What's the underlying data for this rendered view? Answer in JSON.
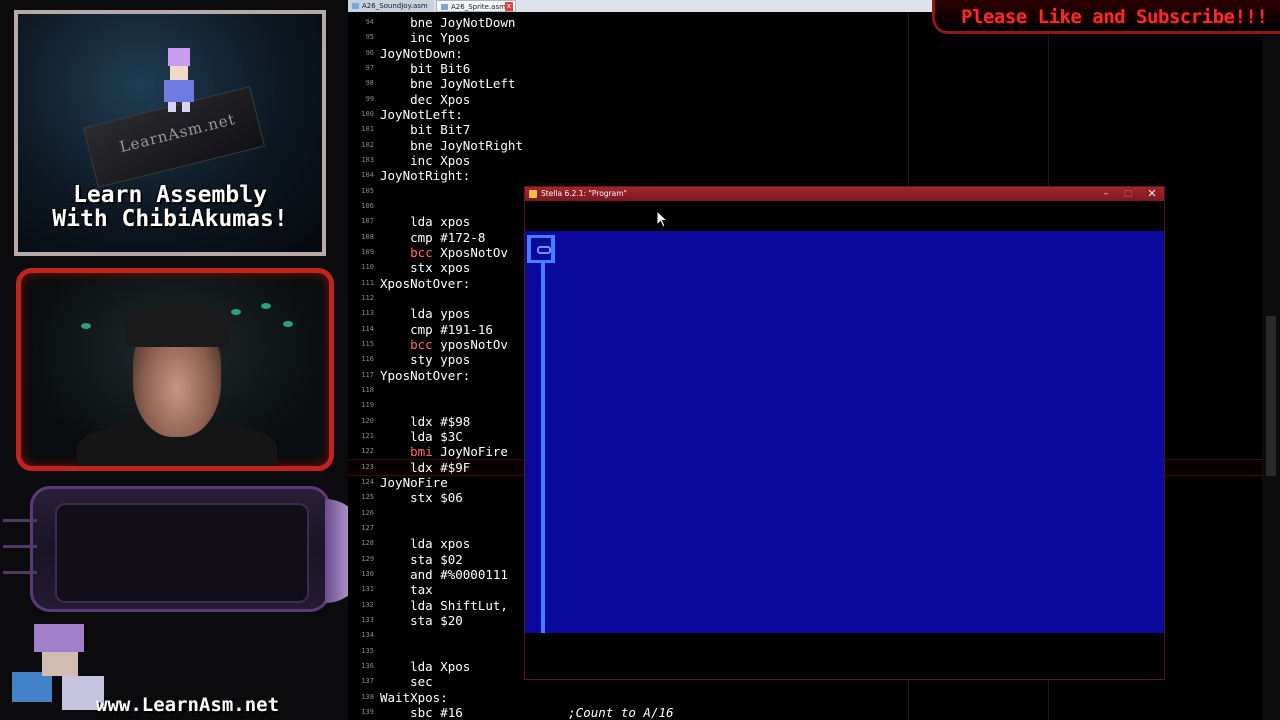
{
  "left_panel": {
    "promo_board_text": "LearnAsm.net",
    "promo_title_line1": "Learn Assembly",
    "promo_title_line2": "With ChibiAkumas!",
    "website": "www.LearnAsm.net"
  },
  "editor": {
    "tabs": [
      {
        "label": "A26_SoundJoy.asm"
      },
      {
        "label": "A26_Sprite.asm",
        "close": "x"
      }
    ],
    "lines": [
      {
        "n": "94",
        "seg": [
          {
            "t": "    bne JoyNotDown",
            "c": "ins"
          }
        ]
      },
      {
        "n": "95",
        "seg": [
          {
            "t": "    inc Ypos",
            "c": "ins"
          }
        ]
      },
      {
        "n": "96",
        "seg": [
          {
            "t": "JoyNotDown:",
            "c": "lbl"
          }
        ]
      },
      {
        "n": "97",
        "seg": [
          {
            "t": "    bit Bit6",
            "c": "ins"
          }
        ]
      },
      {
        "n": "98",
        "seg": [
          {
            "t": "    bne JoyNotLeft",
            "c": "ins"
          }
        ]
      },
      {
        "n": "99",
        "seg": [
          {
            "t": "    dec Xpos",
            "c": "ins"
          }
        ]
      },
      {
        "n": "100",
        "seg": [
          {
            "t": "JoyNotLeft:",
            "c": "lbl"
          }
        ]
      },
      {
        "n": "101",
        "seg": [
          {
            "t": "    bit Bit7",
            "c": "ins"
          }
        ]
      },
      {
        "n": "102",
        "seg": [
          {
            "t": "    bne JoyNotRight",
            "c": "ins"
          }
        ]
      },
      {
        "n": "103",
        "seg": [
          {
            "t": "    inc Xpos",
            "c": "ins"
          }
        ]
      },
      {
        "n": "104",
        "seg": [
          {
            "t": "JoyNotRight:",
            "c": "lbl"
          }
        ]
      },
      {
        "n": "105",
        "seg": [
          {
            "t": "",
            "c": "ins"
          }
        ]
      },
      {
        "n": "106",
        "seg": [
          {
            "t": "",
            "c": "ins"
          }
        ]
      },
      {
        "n": "107",
        "seg": [
          {
            "t": "    lda xpos",
            "c": "ins"
          }
        ]
      },
      {
        "n": "108",
        "seg": [
          {
            "t": "    cmp #172-8",
            "c": "ins"
          }
        ]
      },
      {
        "n": "109",
        "seg": [
          {
            "t": "    ",
            "c": "ins"
          },
          {
            "t": "bcc",
            "c": "br"
          },
          {
            "t": " XposNotOv",
            "c": "ins"
          }
        ]
      },
      {
        "n": "110",
        "seg": [
          {
            "t": "    stx xpos",
            "c": "ins"
          }
        ]
      },
      {
        "n": "111",
        "seg": [
          {
            "t": "XposNotOver:",
            "c": "lbl"
          }
        ]
      },
      {
        "n": "112",
        "seg": [
          {
            "t": "",
            "c": "ins"
          }
        ]
      },
      {
        "n": "113",
        "seg": [
          {
            "t": "    lda ypos",
            "c": "ins"
          }
        ]
      },
      {
        "n": "114",
        "seg": [
          {
            "t": "    cmp #191-16",
            "c": "ins"
          }
        ]
      },
      {
        "n": "115",
        "seg": [
          {
            "t": "    ",
            "c": "ins"
          },
          {
            "t": "bcc",
            "c": "br"
          },
          {
            "t": " yposNotOv",
            "c": "ins"
          }
        ]
      },
      {
        "n": "116",
        "seg": [
          {
            "t": "    sty ypos",
            "c": "ins"
          }
        ]
      },
      {
        "n": "117",
        "seg": [
          {
            "t": "YposNotOver:",
            "c": "lbl"
          }
        ]
      },
      {
        "n": "118",
        "seg": [
          {
            "t": "",
            "c": "ins"
          }
        ]
      },
      {
        "n": "119",
        "seg": [
          {
            "t": "",
            "c": "ins"
          }
        ]
      },
      {
        "n": "120",
        "seg": [
          {
            "t": "    ldx #$98",
            "c": "ins"
          }
        ]
      },
      {
        "n": "121",
        "seg": [
          {
            "t": "    lda $3C",
            "c": "ins"
          }
        ]
      },
      {
        "n": "122",
        "seg": [
          {
            "t": "    ",
            "c": "ins"
          },
          {
            "t": "bmi",
            "c": "br"
          },
          {
            "t": " JoyNoFire",
            "c": "ins"
          }
        ]
      },
      {
        "n": "123",
        "seg": [
          {
            "t": "    ldx #$9F",
            "c": "ins"
          }
        ]
      },
      {
        "n": "124",
        "seg": [
          {
            "t": "JoyNoFire",
            "c": "lbl"
          }
        ]
      },
      {
        "n": "125",
        "seg": [
          {
            "t": "    stx $06",
            "c": "ins"
          }
        ]
      },
      {
        "n": "126",
        "seg": [
          {
            "t": "",
            "c": "ins"
          }
        ]
      },
      {
        "n": "127",
        "seg": [
          {
            "t": "",
            "c": "ins"
          }
        ]
      },
      {
        "n": "128",
        "seg": [
          {
            "t": "    lda xpos",
            "c": "ins"
          }
        ]
      },
      {
        "n": "129",
        "seg": [
          {
            "t": "    sta $02",
            "c": "ins"
          }
        ]
      },
      {
        "n": "130",
        "seg": [
          {
            "t": "    and #%0000111",
            "c": "ins"
          }
        ]
      },
      {
        "n": "131",
        "seg": [
          {
            "t": "    tax",
            "c": "ins"
          }
        ]
      },
      {
        "n": "132",
        "seg": [
          {
            "t": "    lda ShiftLut,",
            "c": "ins"
          }
        ]
      },
      {
        "n": "133",
        "seg": [
          {
            "t": "    sta $20",
            "c": "ins"
          }
        ]
      },
      {
        "n": "134",
        "seg": [
          {
            "t": "",
            "c": "ins"
          }
        ]
      },
      {
        "n": "135",
        "seg": [
          {
            "t": "",
            "c": "ins"
          }
        ]
      },
      {
        "n": "136",
        "seg": [
          {
            "t": "    lda Xpos",
            "c": "ins"
          }
        ]
      },
      {
        "n": "137",
        "seg": [
          {
            "t": "    sec",
            "c": "ins"
          }
        ]
      },
      {
        "n": "138",
        "seg": [
          {
            "t": "WaitXpos:",
            "c": "lbl"
          }
        ]
      },
      {
        "n": "139",
        "seg": [
          {
            "t": "    sbc #16",
            "c": "ins"
          },
          {
            "t": "              ;Count to A/16",
            "c": "cmt"
          }
        ]
      }
    ]
  },
  "banner": {
    "text": "Please Like and Subscribe!!!"
  },
  "stella": {
    "title": "Stella 6.2.1: \"Program\"",
    "minimize": "–",
    "maximize": "□",
    "close": "✕",
    "playfield_color": "#0a0a9c",
    "sprite_color": "#4a7cff"
  }
}
